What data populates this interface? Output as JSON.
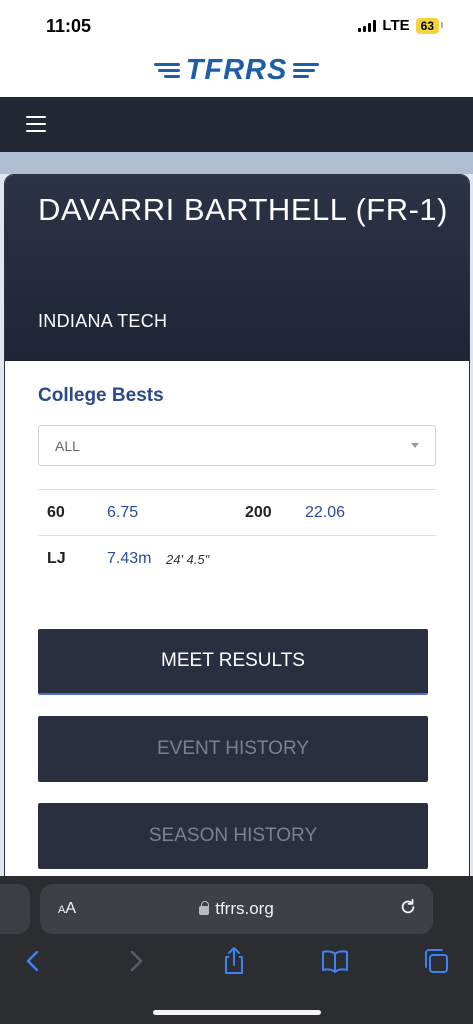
{
  "status_bar": {
    "time": "11:05",
    "network": "LTE",
    "battery": "63"
  },
  "brand": {
    "logo_text": "TFRRS",
    "color": "#1d5ea8"
  },
  "nav": {
    "menu_icon": "hamburger-icon"
  },
  "athlete": {
    "name": "DAVARRI BARTHELL (FR-1)",
    "team": "INDIANA TECH"
  },
  "college_bests": {
    "title": "College Bests",
    "filter": {
      "selected": "ALL"
    },
    "rows": [
      [
        {
          "event": "60",
          "mark": "6.75",
          "converted": ""
        },
        {
          "event": "200",
          "mark": "22.06",
          "converted": ""
        }
      ],
      [
        {
          "event": "LJ",
          "mark": "7.43m",
          "converted": "24' 4.5\""
        }
      ]
    ]
  },
  "buttons": {
    "meet_results": "MEET RESULTS",
    "event_history": "EVENT HISTORY",
    "season_history": "SEASON HISTORY"
  },
  "browser": {
    "aa_label": "AA",
    "url": "tfrrs.org"
  },
  "colors": {
    "nav_dark": "#222733",
    "link_blue": "#2b4c9b",
    "title_blue": "#2a4a8c"
  }
}
